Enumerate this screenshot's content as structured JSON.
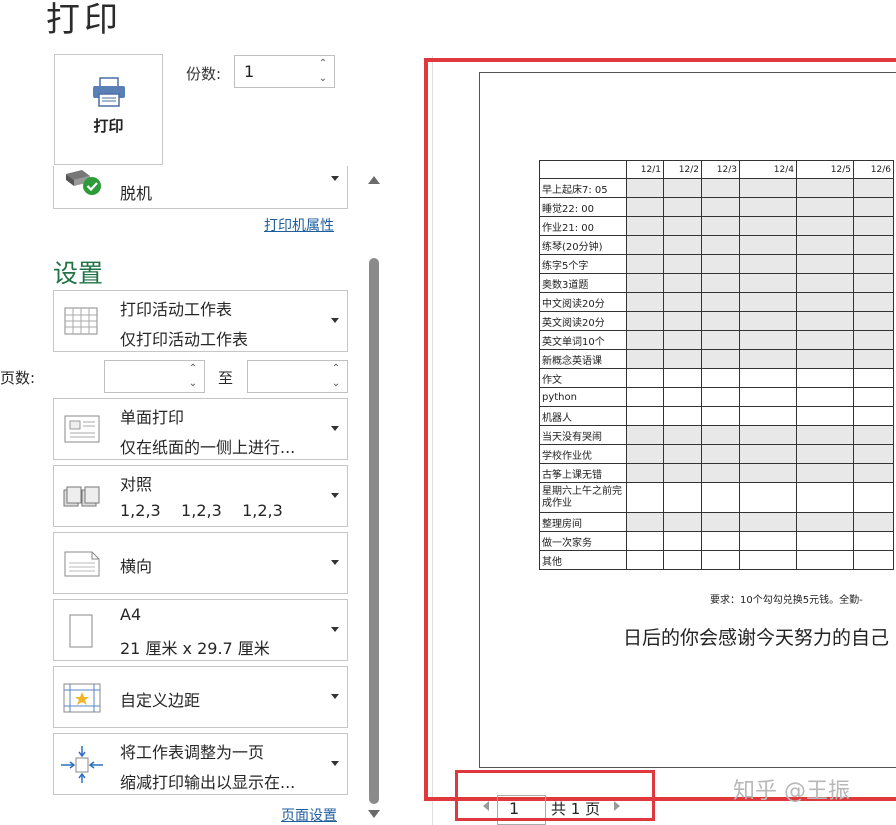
{
  "title": "打印",
  "print_button": {
    "label": "打印"
  },
  "copies": {
    "label": "份数:",
    "value": "1"
  },
  "printer": {
    "name": "脱机",
    "properties_link": "打印机属性"
  },
  "settings": {
    "title": "设置",
    "options": [
      {
        "line1": "打印活动工作表",
        "line2": "仅打印活动工作表",
        "icon": "worksheet-icon"
      },
      {
        "line1": "单面打印",
        "line2": "仅在纸面的一侧上进行...",
        "icon": "one-sided-icon"
      },
      {
        "line1": "对照",
        "line2": "1,2,3    1,2,3    1,2,3",
        "icon": "collate-icon"
      },
      {
        "line1": "横向",
        "line2": "",
        "icon": "landscape-icon"
      },
      {
        "line1": "A4",
        "line2": "21 厘米 x 29.7 厘米",
        "icon": "paper-size-icon"
      },
      {
        "line1": "自定义边距",
        "line2": "",
        "icon": "margins-icon"
      },
      {
        "line1": "将工作表调整为一页",
        "line2": "缩减打印输出以显示在...",
        "icon": "fit-to-page-icon"
      }
    ],
    "pages_label": "页数:",
    "pages_to": "至",
    "page_setup_link": "页面设置"
  },
  "preview": {
    "columns": [
      "12/1",
      "12/2",
      "12/3",
      "12/4",
      "12/5",
      "12/6"
    ],
    "rows": [
      {
        "label": "早上起床7: 05",
        "shaded": true
      },
      {
        "label": "睡觉22: 00",
        "shaded": true
      },
      {
        "label": "作业21: 00",
        "shaded": true
      },
      {
        "label": "练琴(20分钟)",
        "shaded": true
      },
      {
        "label": "练字5个字",
        "shaded": true
      },
      {
        "label": "奥数3道题",
        "shaded": true
      },
      {
        "label": "中文阅读20分",
        "shaded": true
      },
      {
        "label": "英文阅读20分",
        "shaded": true
      },
      {
        "label": "英文单词10个",
        "shaded": true
      },
      {
        "label": "新概念英语课",
        "shaded": true
      },
      {
        "label": "作文",
        "shaded": false
      },
      {
        "label": "python",
        "shaded": false
      },
      {
        "label": "机器人",
        "shaded": false
      },
      {
        "label": "当天没有哭闹",
        "shaded": true
      },
      {
        "label": "学校作业优",
        "shaded": true
      },
      {
        "label": "古筝上课无错",
        "shaded": true
      },
      {
        "label": "星期六上午之前完成作业",
        "shaded": false,
        "tall": true
      },
      {
        "label": "整理房间",
        "shaded": true
      },
      {
        "label": "做一次家务",
        "shaded": false
      },
      {
        "label": "其他",
        "shaded": false
      }
    ],
    "note": "要求：10个勾勾兑换5元钱。全勤-",
    "motto": "日后的你会感谢今天努力的自己"
  },
  "pager": {
    "current": "1",
    "total": "共 1 页"
  },
  "watermark": "知乎 @王振",
  "colors": {
    "accent": "#217346",
    "highlight": "#e0393d",
    "link": "#1e5e9e"
  }
}
